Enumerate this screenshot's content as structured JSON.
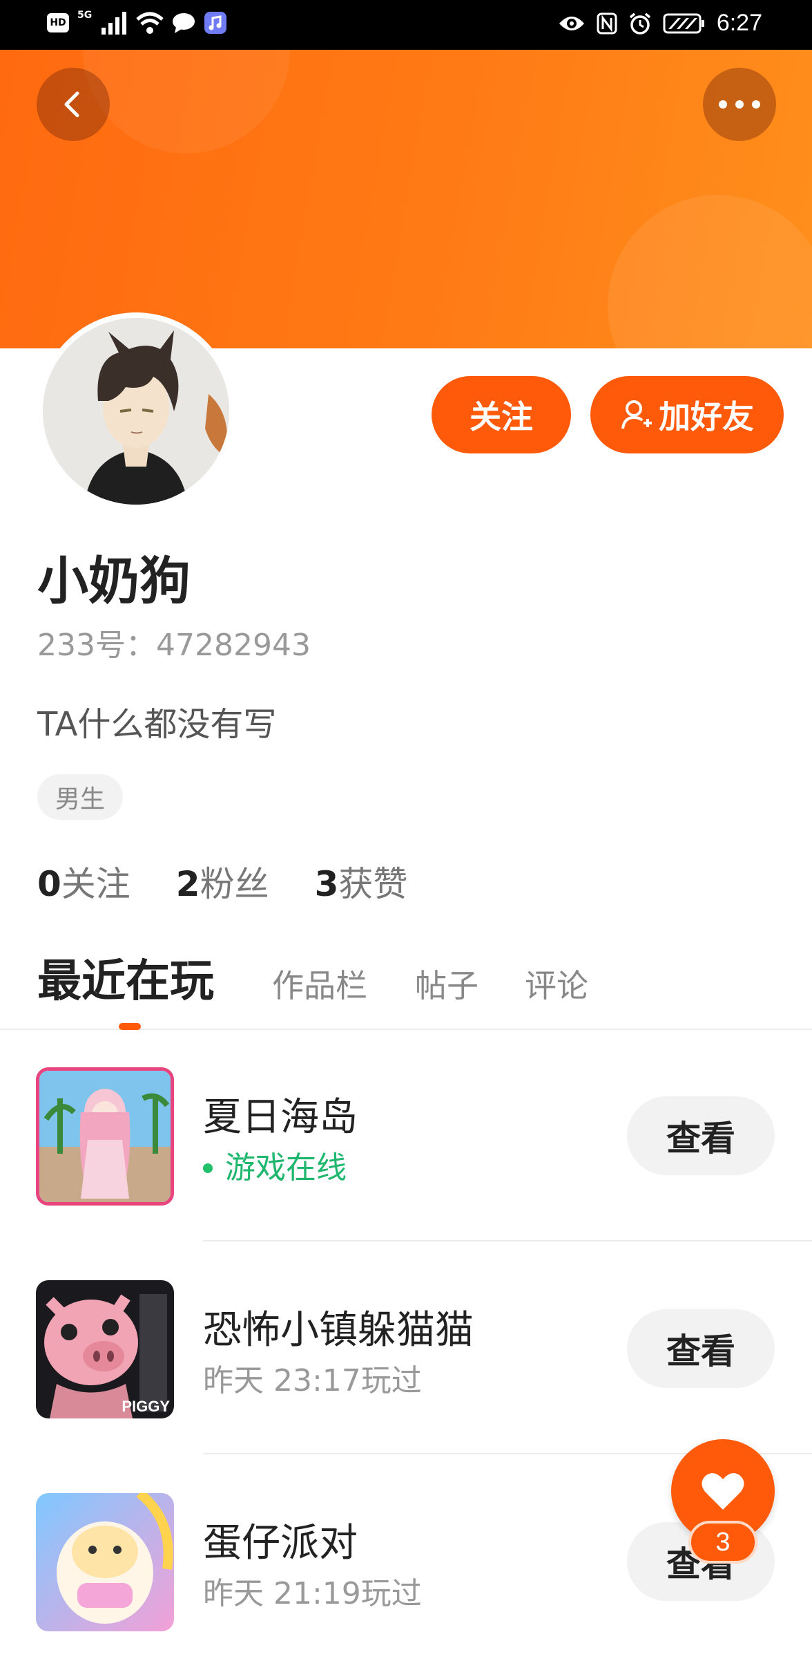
{
  "status_bar": {
    "hd_label": "HD",
    "network_label": "5G",
    "time": "6:27"
  },
  "header": {
    "back_icon": "chevron-left-icon",
    "more_icon": "ellipsis-icon",
    "banner_color": "#ff7a15"
  },
  "profile": {
    "follow_button": "关注",
    "add_friend_button": "加好友",
    "nickname": "小奶狗",
    "uid_label": "233号：",
    "uid_value": "47282943",
    "bio": "TA什么都没有写",
    "gender_tag": "男生"
  },
  "stats": [
    {
      "num": "0",
      "label": "关注"
    },
    {
      "num": "2",
      "label": "粉丝"
    },
    {
      "num": "3",
      "label": "获赞"
    }
  ],
  "tabs": [
    {
      "label": "最近在玩",
      "active": true
    },
    {
      "label": "作品栏",
      "active": false
    },
    {
      "label": "帖子",
      "active": false
    },
    {
      "label": "评论",
      "active": false
    }
  ],
  "games": [
    {
      "name": "夏日海岛",
      "status": "游戏在线",
      "online": true,
      "button": "查看"
    },
    {
      "name": "恐怖小镇躲猫猫",
      "status": "昨天 23:17玩过",
      "online": false,
      "button": "查看",
      "thumb_text": "PIGGY"
    },
    {
      "name": "蛋仔派对",
      "status": "昨天 21:19玩过",
      "online": false,
      "button": "查看"
    }
  ],
  "like_fab": {
    "icon": "heart-icon",
    "count": "3"
  },
  "colors": {
    "accent": "#ff5a0a",
    "online": "#1fb66e"
  }
}
